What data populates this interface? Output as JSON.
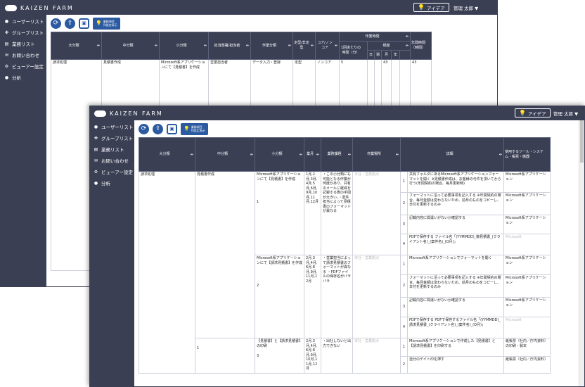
{
  "app": {
    "logo_text": "KAIZEN FARM",
    "idea_label": "アイデア",
    "user_label": "管理 太郎 ▼"
  },
  "sidebar": {
    "items": [
      {
        "icon": "user-icon",
        "glyph": "●",
        "label": "ユーザーリスト"
      },
      {
        "icon": "group-icon",
        "glyph": "✤",
        "label": "グループリスト"
      },
      {
        "icon": "list-icon",
        "glyph": "▤",
        "label": "業務リスト"
      },
      {
        "icon": "mail-icon",
        "glyph": "✉",
        "label": "お問い合わせ"
      },
      {
        "icon": "settings-icon",
        "glyph": "⚙",
        "label": "ビューアー設定"
      },
      {
        "icon": "analysis-icon",
        "glyph": "●",
        "label": "分析"
      }
    ]
  },
  "toolbar": {
    "settings_btn_line1": "業務項目",
    "settings_btn_line2": "列設定表示"
  },
  "table1": {
    "headers": {
      "major": "大分類",
      "middle": "中分類",
      "minor": "小分類",
      "dept": "担当部署/担当者",
      "work_type": "作業分類",
      "fixed": "定型/非定型",
      "core": "コア/ノンコア",
      "work_time": "作業時間",
      "per_time": "1回あたりの時間（分）",
      "frequency": "頻度",
      "freq_d": "日",
      "freq_w": "週",
      "freq_m": "月",
      "freq_y": "年",
      "annual": "年間時間（時間）"
    },
    "row": {
      "major": "請求処理",
      "middle": "見積書作成",
      "minor": "Microsoft系アプリケーションにて【見積書】を作成",
      "dept": "営業担当者",
      "work_type": "データ入力・登録",
      "fixed": "定型",
      "core": "ノンコア",
      "per_time": "5",
      "freq_m": "43",
      "annual": "43"
    }
  },
  "table2": {
    "headers": {
      "major": "大分類",
      "middle": "中分類",
      "minor": "小分類",
      "month": "業月",
      "issue": "業務課題",
      "place": "作業場所",
      "detail": "詳細",
      "tools": "使用するツール・システム・帳票・機器"
    },
    "major": "請求処理",
    "middle": "見積書作成",
    "middle_no": "1",
    "groups": [
      {
        "no": "1",
        "minor": "Microsoft系アプリケーションにて【見積書】を作成",
        "month": "1月,2月,3月,4月,5月,6月,9月,10月,11月,12月",
        "issue": "・この小分類にも可能となる作業が何度かあり、共有のメールに経緯を記録する際の手間が大きい。・案件担当によって見積書のフォーマットが異なる",
        "place": "本社・営業拠点",
        "steps": [
          {
            "no": "1",
            "detail": "共有フォルダにあるMicrosoft系アプリケーションフォーマットを開く ※見積書作成は、お客様の与件を頂いてから行う(年間契約の場合、毎月更新時)",
            "tool": "Microsoft系アプリケーション"
          },
          {
            "no": "2",
            "detail": "フォーマットに沿って必要事項を記入する ※年間契約の場合、毎月金額は変わらないため、前月のものをコピーし、日付を更新するのみ",
            "tool": "Microsoft系アプリケーション"
          },
          {
            "no": "3",
            "detail": "記載内容に間違いがないか確認する",
            "tool": "Microsoft系アプリケーション"
          },
          {
            "no": "4",
            "detail": "PDFで保存する ファイル名「(YYMMDD)_御見積書_(クライアント名)_(案件名)_(O月)」",
            "tool": "Microsoft"
          }
        ]
      },
      {
        "no": "2",
        "minor": "Microsoft系アプリケーションにて【請求見積書】を作成",
        "month": "2月,3月,4月,6月,8月,9月,11月,12月",
        "issue": "・営業担当によって請求見積書のフォーマットが異なる ・PDFファイルの保存名がバラバラ",
        "place": "本社・営業拠点",
        "steps": [
          {
            "no": "1",
            "detail": "Microsoft系アプリケーションでフォーマットを開く",
            "tool": "Microsoft系アプリケーション"
          },
          {
            "no": "2",
            "detail": "フォーマットに沿って必要事項を記入する ※年間契約の場合、毎月金額は変わらないため、前月のものをコピーし、日付を更新するのみ",
            "tool": "Microsoft系アプリケーション"
          },
          {
            "no": "3",
            "detail": "記載内容に間違いがないか確認する",
            "tool": "Microsoft系アプリケーション"
          },
          {
            "no": "4",
            "detail": "PDFで保存する PDFで保存するファイル名「(YYMMDD)_請求見積書_(クライアント名)_(案件名)_(O月)」",
            "tool": "Microsoft"
          }
        ]
      },
      {
        "no": "3",
        "minor": "【見積書】と【請求見積書】の印刷",
        "month": "2月,3月,4月,6月,8月,9月,10月,11月,12月",
        "issue": "・出社しないと出力できない",
        "place": "本社・営業拠点",
        "steps": [
          {
            "no": "1",
            "detail": "Microsoft系アプリケーションで作成した【見積書】と【請求見積書】を印刷する",
            "tool": "紙帳票（社内／庁内資料）の印刷・製本"
          },
          {
            "no": "2",
            "detail": "自分のデイト印を押す",
            "tool": "紙帳票（社内／庁内資料）"
          }
        ]
      }
    ]
  }
}
